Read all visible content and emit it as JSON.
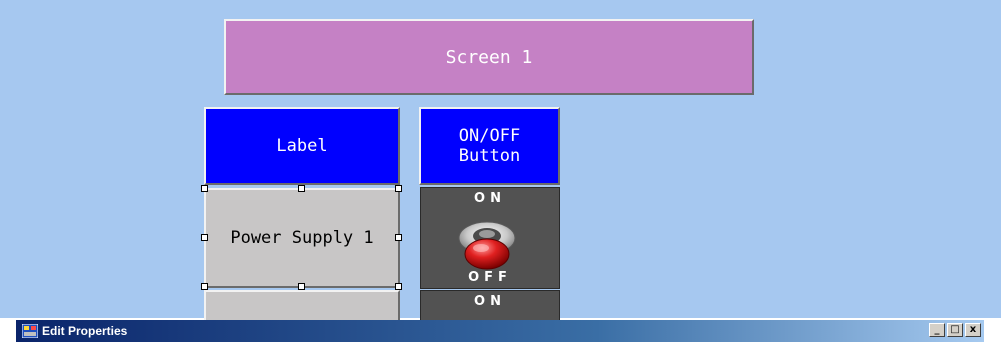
{
  "screen": {
    "title": "Screen 1"
  },
  "headers": {
    "label": "Label",
    "onoff_line1": "ON/OFF",
    "onoff_line2": "Button"
  },
  "rows": [
    {
      "label": "Power Supply 1",
      "toggle_top": "ON",
      "toggle_bottom": "OFF"
    },
    {
      "label": "",
      "toggle_top": "ON"
    }
  ],
  "window": {
    "title": "Edit Properties",
    "minimize": "_",
    "maximize": "□",
    "close": "x"
  },
  "colors": {
    "background": "#a6c8f0",
    "title_box": "#c581c5",
    "header": "#0000ff",
    "cell": "#c8c6c6",
    "toggle_panel": "#525252",
    "toggle_knob": "#d81a1a"
  },
  "icons": {
    "toggle": "toggle-switch-icon",
    "window": "window-app-icon"
  }
}
